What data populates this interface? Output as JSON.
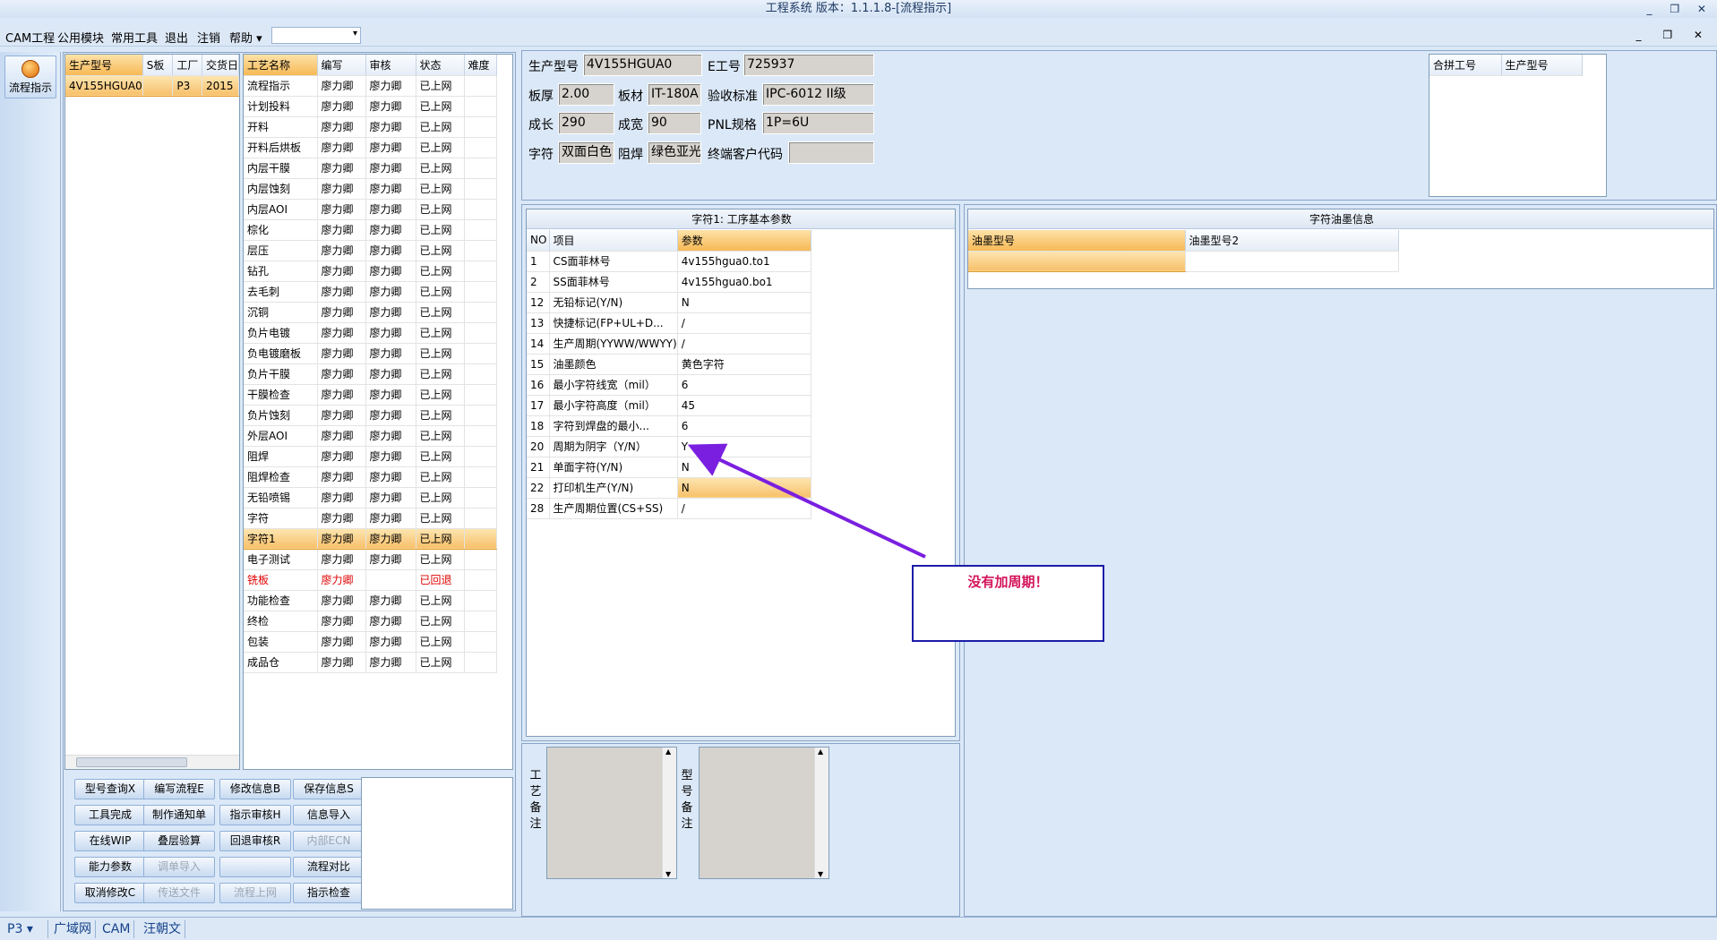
{
  "app": {
    "title": "工程系统 版本：1.1.1.8-[流程指示]",
    "window_controls": "_ ❐ ✕",
    "mdi_controls": "_ ❐ ✕"
  },
  "menu": [
    "CAM工程",
    "公用模块",
    "常用工具",
    "退出",
    "注销",
    "帮助"
  ],
  "menu_dropdown_arrow": "▾",
  "sidebar": {
    "button_label": "流程指示",
    "icon": "flow-icon"
  },
  "order_grid": {
    "columns": [
      "生产型号",
      "S板",
      "工厂",
      "交货日"
    ],
    "rows": [
      [
        "4V155HGUA0",
        "",
        "P3",
        "2015"
      ]
    ]
  },
  "process_grid": {
    "columns": [
      "工艺名称",
      "编写",
      "审核",
      "状态",
      "难度"
    ],
    "rows": [
      {
        "name": "流程指示",
        "writer": "廖力卿",
        "reviewer": "廖力卿",
        "status": "已上网"
      },
      {
        "name": "计划投料",
        "writer": "廖力卿",
        "reviewer": "廖力卿",
        "status": "已上网"
      },
      {
        "name": "开料",
        "writer": "廖力卿",
        "reviewer": "廖力卿",
        "status": "已上网"
      },
      {
        "name": "开料后烘板",
        "writer": "廖力卿",
        "reviewer": "廖力卿",
        "status": "已上网"
      },
      {
        "name": "内层干膜",
        "writer": "廖力卿",
        "reviewer": "廖力卿",
        "status": "已上网"
      },
      {
        "name": "内层蚀刻",
        "writer": "廖力卿",
        "reviewer": "廖力卿",
        "status": "已上网"
      },
      {
        "name": "内层AOI",
        "writer": "廖力卿",
        "reviewer": "廖力卿",
        "status": "已上网"
      },
      {
        "name": "棕化",
        "writer": "廖力卿",
        "reviewer": "廖力卿",
        "status": "已上网"
      },
      {
        "name": "层压",
        "writer": "廖力卿",
        "reviewer": "廖力卿",
        "status": "已上网"
      },
      {
        "name": "钻孔",
        "writer": "廖力卿",
        "reviewer": "廖力卿",
        "status": "已上网"
      },
      {
        "name": "去毛刺",
        "writer": "廖力卿",
        "reviewer": "廖力卿",
        "status": "已上网"
      },
      {
        "name": "沉铜",
        "writer": "廖力卿",
        "reviewer": "廖力卿",
        "status": "已上网"
      },
      {
        "name": "负片电镀",
        "writer": "廖力卿",
        "reviewer": "廖力卿",
        "status": "已上网"
      },
      {
        "name": "负电镀磨板",
        "writer": "廖力卿",
        "reviewer": "廖力卿",
        "status": "已上网"
      },
      {
        "name": "负片干膜",
        "writer": "廖力卿",
        "reviewer": "廖力卿",
        "status": "已上网"
      },
      {
        "name": "干膜检查",
        "writer": "廖力卿",
        "reviewer": "廖力卿",
        "status": "已上网"
      },
      {
        "name": "负片蚀刻",
        "writer": "廖力卿",
        "reviewer": "廖力卿",
        "status": "已上网"
      },
      {
        "name": "外层AOI",
        "writer": "廖力卿",
        "reviewer": "廖力卿",
        "status": "已上网"
      },
      {
        "name": "阻焊",
        "writer": "廖力卿",
        "reviewer": "廖力卿",
        "status": "已上网"
      },
      {
        "name": "阻焊检查",
        "writer": "廖力卿",
        "reviewer": "廖力卿",
        "status": "已上网"
      },
      {
        "name": "无铅喷锡",
        "writer": "廖力卿",
        "reviewer": "廖力卿",
        "status": "已上网"
      },
      {
        "name": "字符",
        "writer": "廖力卿",
        "reviewer": "廖力卿",
        "status": "已上网"
      },
      {
        "name": "字符1",
        "writer": "廖力卿",
        "reviewer": "廖力卿",
        "status": "已上网",
        "selected": true
      },
      {
        "name": "电子测试",
        "writer": "廖力卿",
        "reviewer": "廖力卿",
        "status": "已上网"
      },
      {
        "name": "铣板",
        "writer": "廖力卿",
        "reviewer": "",
        "status": "已回退",
        "red": true
      },
      {
        "name": "功能检查",
        "writer": "廖力卿",
        "reviewer": "廖力卿",
        "status": "已上网"
      },
      {
        "name": "终检",
        "writer": "廖力卿",
        "reviewer": "廖力卿",
        "status": "已上网"
      },
      {
        "name": "包装",
        "writer": "廖力卿",
        "reviewer": "廖力卿",
        "status": "已上网"
      },
      {
        "name": "成品仓",
        "writer": "廖力卿",
        "reviewer": "廖力卿",
        "status": "已上网"
      }
    ]
  },
  "buttons": [
    [
      "型号查询X",
      "编写流程E",
      "修改信息B",
      "保存信息S"
    ],
    [
      "工具完成",
      "制作通知单",
      "指示审核H",
      "信息导入"
    ],
    [
      "在线WIP",
      "叠层验算",
      "回退审核R",
      "内部ECN"
    ],
    [
      "能力参数",
      "调单导入",
      "",
      "流程对比"
    ],
    [
      "取消修改C",
      "传送文件",
      "流程上网",
      "指示检查"
    ]
  ],
  "disabled_buttons": [
    "内部ECN",
    "调单导入",
    "传送文件",
    "流程上网"
  ],
  "info": {
    "model_label": "生产型号",
    "model_value": "4V155HGUA0",
    "eno_label": "E工号",
    "eno_value": "725937",
    "thick_label": "板厚",
    "thick_value": "2.00",
    "material_label": "板材",
    "material_value": "IT-180A",
    "std_label": "验收标准",
    "std_value": "IPC-6012 II级",
    "len_label": "成长",
    "len_value": "290",
    "wid_label": "成宽",
    "wid_value": "90",
    "pnl_label": "PNL规格",
    "pnl_value": "1P=6U",
    "char_label": "字符",
    "char_value": "双面白色",
    "mask_label": "阻焊",
    "mask_value": "绿色亚光",
    "cust_label": "终端客户代码",
    "cust_value": ""
  },
  "merge_grid": {
    "columns": [
      "合拼工号",
      "生产型号"
    ]
  },
  "params": {
    "title": "字符1: 工序基本参数",
    "columns": [
      "NO",
      "项目",
      "参数"
    ],
    "rows": [
      {
        "no": "1",
        "item": "CS面菲林号",
        "val": "4v155hgua0.to1"
      },
      {
        "no": "2",
        "item": "SS面菲林号",
        "val": "4v155hgua0.bo1"
      },
      {
        "no": "12",
        "item": "无铅标记(Y/N)",
        "val": "N"
      },
      {
        "no": "13",
        "item": "快捷标记(FP+UL+D...",
        "val": "/"
      },
      {
        "no": "14",
        "item": "生产周期(YYWW/WWYY)",
        "val": "/"
      },
      {
        "no": "15",
        "item": "油墨颜色",
        "val": "黄色字符"
      },
      {
        "no": "16",
        "item": "最小字符线宽（mil）",
        "val": "6"
      },
      {
        "no": "17",
        "item": "最小字符高度（mil）",
        "val": "45"
      },
      {
        "no": "18",
        "item": "字符到焊盘的最小...",
        "val": "6"
      },
      {
        "no": "20",
        "item": "周期为阴字（Y/N）",
        "val": "Y"
      },
      {
        "no": "21",
        "item": "单面字符(Y/N)",
        "val": "N"
      },
      {
        "no": "22",
        "item": "打印机生产(Y/N)",
        "val": "N",
        "sel": true
      },
      {
        "no": "28",
        "item": "生产周期位置(CS+SS)",
        "val": "/"
      }
    ]
  },
  "ink": {
    "title": "字符油墨信息",
    "columns": [
      "油墨型号",
      "油墨型号2"
    ]
  },
  "remarks": {
    "process_label": "工艺备注",
    "model_label": "型号备注"
  },
  "callout": "没有加周期！",
  "status": [
    "P3",
    "广域网",
    "CAM",
    "汪朝文"
  ],
  "status_dropdown_arrow": "▾",
  "colors": {
    "selected": "#f7c06a",
    "red": "#e00000",
    "arrow": "#7a1fe0",
    "callout_border": "#1c1ca8",
    "callout_text": "#d4145a"
  }
}
